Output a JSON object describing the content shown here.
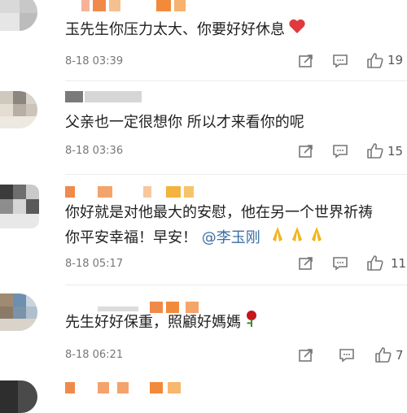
{
  "comments": [
    {
      "text": "玉先生你压力太大、你要好好休息",
      "emoji": "heart-emoji",
      "time": "8-18 03:39",
      "likes": "19"
    },
    {
      "text": "父亲也一定很想你 所以才来看你的呢",
      "time": "8-18 03:36",
      "likes": "15"
    },
    {
      "text_line1": "你好就是对他最大的安慰，他在另一个世界祈祷",
      "text_line2": "你平安幸福！早安！",
      "mention": "@李玉刚",
      "emoji": "praying-hands-emoji",
      "time": "8-18 05:17",
      "likes": "11"
    },
    {
      "text": "先生好好保重，照顧好媽媽",
      "emoji": "rose-emoji",
      "time": "8-18 06:21",
      "likes": "7"
    }
  ],
  "icons": {
    "share": "share-icon",
    "comment": "comment-icon",
    "like": "thumbs-up-icon"
  },
  "colors": {
    "mention": "#3a6ea5",
    "heart": "#e0393e",
    "rose": "#c4161c",
    "praying_hands": "#f2b51c"
  }
}
